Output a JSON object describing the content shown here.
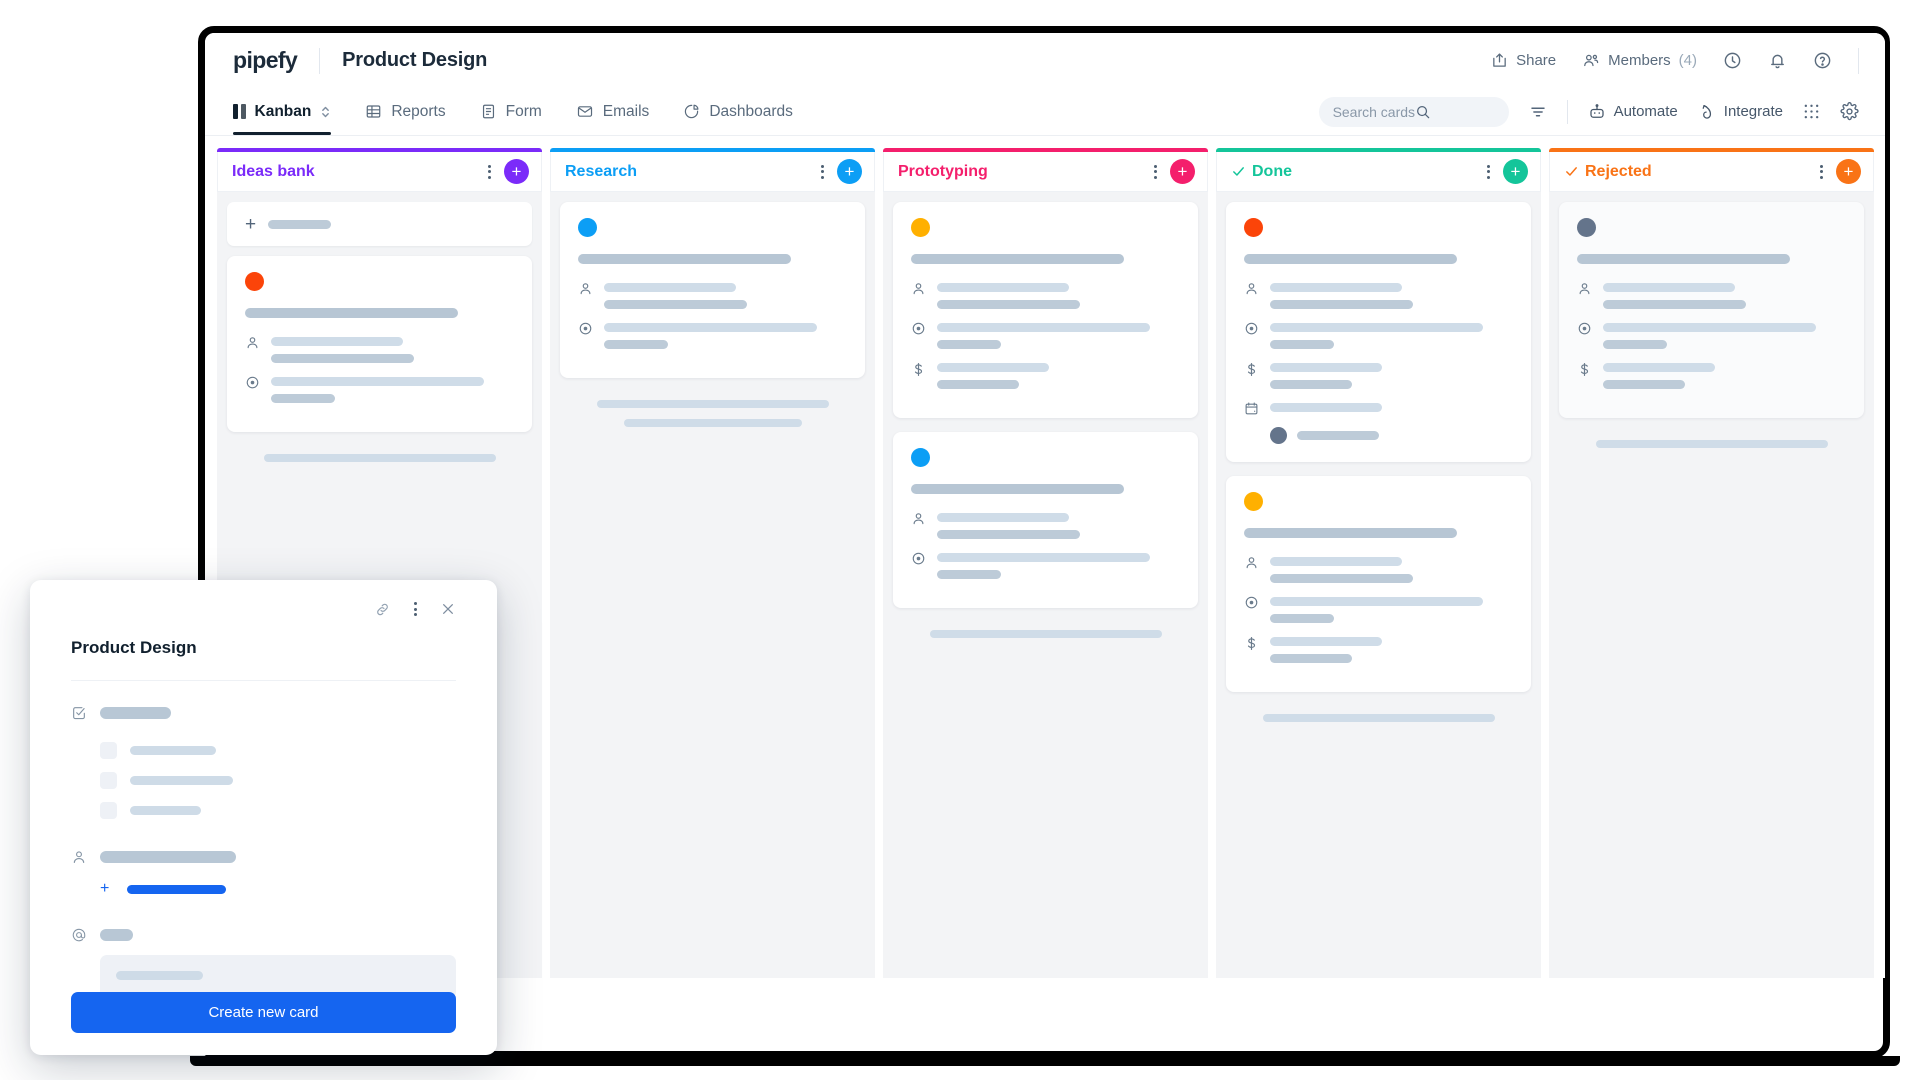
{
  "app": {
    "logo": "pipefy",
    "pipe_title": "Product Design"
  },
  "topbar": {
    "share_label": "Share",
    "members_label": "Members",
    "members_count": "(4)",
    "icons": [
      "share-icon",
      "members-icon",
      "history-icon",
      "bell-icon",
      "help-icon"
    ]
  },
  "nav": {
    "tabs": [
      {
        "label": "Kanban",
        "icon": "kanban-icon",
        "active": true
      },
      {
        "label": "Reports",
        "icon": "table-icon",
        "active": false
      },
      {
        "label": "Form",
        "icon": "form-icon",
        "active": false
      },
      {
        "label": "Emails",
        "icon": "envelope-icon",
        "active": false
      },
      {
        "label": "Dashboards",
        "icon": "pie-chart-icon",
        "active": false
      }
    ],
    "search_placeholder": "Search cards",
    "filter_icon": "filter-icon",
    "automate_label": "Automate",
    "integrate_label": "Integrate",
    "apps_icon": "apps-grid-icon",
    "settings_icon": "gear-icon"
  },
  "board": {
    "columns": [
      {
        "title": "Ideas bank",
        "color": "#7B2BF9",
        "has_check": false,
        "add_card_row": true,
        "cards": [
          {
            "dot": "#FB4409",
            "muted": false,
            "fields": [
              "person",
              "target"
            ],
            "extra_bottom": false
          }
        ],
        "skeleton_lines": [
          1
        ]
      },
      {
        "title": "Research",
        "color": "#0C9EF5",
        "has_check": false,
        "add_card_row": false,
        "cards": [
          {
            "dot": "#0C9EF5",
            "muted": false,
            "fields": [
              "person",
              "target"
            ],
            "extra_bottom": false
          }
        ],
        "skeleton_lines": [
          2
        ]
      },
      {
        "title": "Prototyping",
        "color": "#F41F6C",
        "has_check": false,
        "add_card_row": false,
        "cards": [
          {
            "dot": "#FFB000",
            "muted": false,
            "fields": [
              "person",
              "target",
              "money"
            ],
            "extra_bottom": false
          },
          {
            "dot": "#0C9EF5",
            "muted": false,
            "fields": [
              "person",
              "target"
            ],
            "extra_bottom": false
          }
        ],
        "skeleton_lines": [
          1
        ]
      },
      {
        "title": "Done",
        "color": "#14C59A",
        "has_check": true,
        "add_card_row": false,
        "cards": [
          {
            "dot": "#FB4409",
            "muted": false,
            "fields": [
              "person",
              "target",
              "money",
              "calendar"
            ],
            "extra_bottom": true
          },
          {
            "dot": "#FFB000",
            "muted": false,
            "fields": [
              "person",
              "target",
              "money"
            ],
            "extra_bottom": false
          }
        ],
        "skeleton_lines": [
          1
        ]
      },
      {
        "title": "Rejected",
        "color": "#F97316",
        "has_check": true,
        "add_card_row": false,
        "cards": [
          {
            "dot": "#64748B",
            "muted": true,
            "fields": [
              "person",
              "target",
              "money"
            ],
            "extra_bottom": false
          }
        ],
        "skeleton_lines": [
          1
        ]
      }
    ]
  },
  "modal": {
    "title": "Product Design",
    "tools": [
      "link-icon",
      "kebab-icon",
      "close-icon"
    ],
    "create_button": "Create new card",
    "fields": [
      {
        "icon": "checkbox-icon",
        "type": "label"
      },
      {
        "icon": "",
        "type": "checkbox-option"
      },
      {
        "icon": "",
        "type": "checkbox-option"
      },
      {
        "icon": "",
        "type": "checkbox-option"
      },
      {
        "icon": "person-icon",
        "type": "assignee"
      },
      {
        "icon": "",
        "type": "add-link"
      },
      {
        "icon": "at-icon",
        "type": "email"
      }
    ]
  }
}
